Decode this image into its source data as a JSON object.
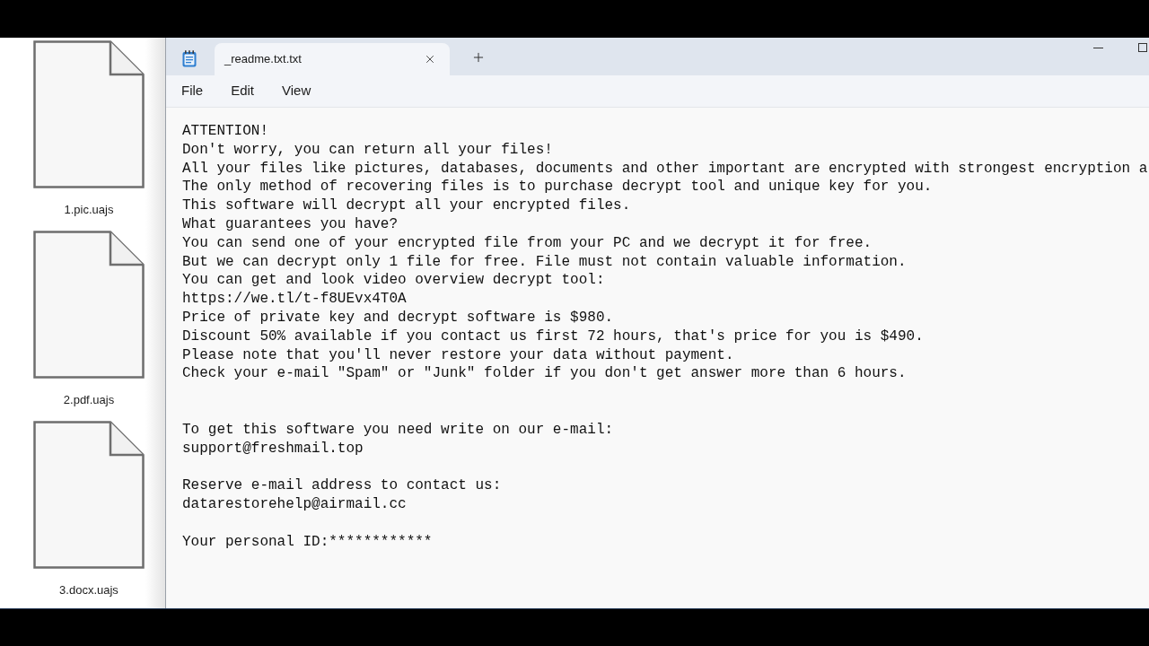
{
  "desktop": {
    "files": [
      {
        "name": "1.pic.uajs"
      },
      {
        "name": "2.pdf.uajs"
      },
      {
        "name": "3.docx.uajs"
      }
    ]
  },
  "window": {
    "tabs": [
      {
        "title": "_readme.txt.txt",
        "selected": true
      }
    ],
    "menu": [
      "File",
      "Edit",
      "View"
    ],
    "content": "ATTENTION!\nDon't worry, you can return all your files!\nAll your files like pictures, databases, documents and other important are encrypted with strongest encryption a\nThe only method of recovering files is to purchase decrypt tool and unique key for you.\nThis software will decrypt all your encrypted files.\nWhat guarantees you have?\nYou can send one of your encrypted file from your PC and we decrypt it for free.\nBut we can decrypt only 1 file for free. File must not contain valuable information.\nYou can get and look video overview decrypt tool:\nhttps://we.tl/t-f8UEvx4T0A\nPrice of private key and decrypt software is $980.\nDiscount 50% available if you contact us first 72 hours, that's price for you is $490.\nPlease note that you'll never restore your data without payment.\nCheck your e-mail \"Spam\" or \"Junk\" folder if you don't get answer more than 6 hours.\n\n\nTo get this software you need write on our e-mail:\nsupport@freshmail.top\n\nReserve e-mail address to contact us:\ndatarestorehelp@airmail.cc\n\nYour personal ID:************"
  }
}
